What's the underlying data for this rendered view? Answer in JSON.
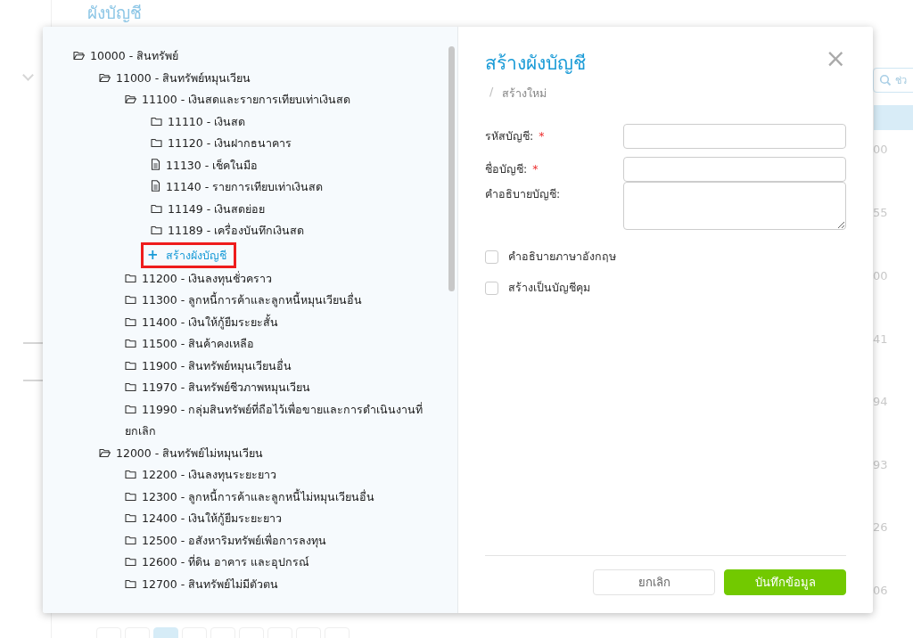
{
  "background": {
    "title": "ผังบัญชี",
    "search": {
      "kind": "search",
      "placeholder": "ช่ว"
    },
    "column_values": [
      "00",
      "55",
      "00",
      "41",
      "94",
      "93",
      "26",
      "06"
    ]
  },
  "tree": [
    {
      "label": "10000 - สินทรัพย์",
      "kind": "folder",
      "expanded": true,
      "children": [
        {
          "label": "11000 - สินทรัพย์หมุนเวียน",
          "kind": "folder",
          "expanded": true,
          "children": [
            {
              "label": "11100 - เงินสดและรายการเทียบเท่าเงินสด",
              "kind": "folder",
              "expanded": true,
              "children": [
                {
                  "label": "11110 - เงินสด",
                  "kind": "folder",
                  "expanded": false
                },
                {
                  "label": "11120 - เงินฝากธนาคาร",
                  "kind": "folder",
                  "expanded": false
                },
                {
                  "label": "11130 - เช็คในมือ",
                  "kind": "file"
                },
                {
                  "label": "11140 - รายการเทียบเท่าเงินสด",
                  "kind": "file"
                },
                {
                  "label": "11149 - เงินสดย่อย",
                  "kind": "folder",
                  "expanded": false
                },
                {
                  "label": "11189 - เครื่องบันทึกเงินสด",
                  "kind": "folder",
                  "expanded": false
                },
                {
                  "label": "สร้างผังบัญชี",
                  "kind": "action",
                  "icon": "+",
                  "highlighted": true
                }
              ]
            },
            {
              "label": "11200 - เงินลงทุนชั่วคราว",
              "kind": "folder",
              "expanded": false
            },
            {
              "label": "11300 - ลูกหนี้การค้าและลูกหนี้หมุนเวียนอื่น",
              "kind": "folder",
              "expanded": false
            },
            {
              "label": "11400 - เงินให้กู้ยืมระยะสั้น",
              "kind": "folder",
              "expanded": false
            },
            {
              "label": "11500 - สินค้าคงเหลือ",
              "kind": "folder",
              "expanded": false
            },
            {
              "label": "11900 - สินทรัพย์หมุนเวียนอื่น",
              "kind": "folder",
              "expanded": false
            },
            {
              "label": "11970 - สินทรัพย์ชีวภาพหมุนเวียน",
              "kind": "folder",
              "expanded": false
            },
            {
              "label": "11990 - กลุ่มสินทรัพย์ที่ถือไว้เพื่อขายและการดำเนินงานที่ยกเลิก",
              "kind": "folder",
              "expanded": false
            }
          ]
        },
        {
          "label": "12000 - สินทรัพย์ไม่หมุนเวียน",
          "kind": "folder",
          "expanded": true,
          "children": [
            {
              "label": "12200 - เงินลงทุนระยะยาว",
              "kind": "folder",
              "expanded": false
            },
            {
              "label": "12300 - ลูกหนี้การค้าและลูกหนี้ไม่หมุนเวียนอื่น",
              "kind": "folder",
              "expanded": false
            },
            {
              "label": "12400 - เงินให้กู้ยืมระยะยาว",
              "kind": "folder",
              "expanded": false
            },
            {
              "label": "12500 - อสังหาริมทรัพย์เพื่อการลงทุน",
              "kind": "folder",
              "expanded": false
            },
            {
              "label": "12600 - ที่ดิน อาคาร และอุปกรณ์",
              "kind": "folder",
              "expanded": false
            },
            {
              "label": "12700 - สินทรัพย์ไม่มีตัวตน",
              "kind": "folder",
              "expanded": false
            }
          ]
        }
      ]
    }
  ],
  "form": {
    "title": "สร้างผังบัญชี",
    "breadcrumb": {
      "separator": "/",
      "label": "สร้างใหม่"
    },
    "fields": [
      {
        "label": "รหัสบัญชี:",
        "required": true,
        "kind": "input"
      },
      {
        "label": "ชื่อบัญชี:",
        "required": true,
        "kind": "input"
      },
      {
        "label": "คำอธิบายบัญชี:",
        "required": false,
        "kind": "textarea"
      }
    ],
    "required_mark": "*",
    "checkboxes": [
      {
        "label": "คำอธิบายภาษาอังกฤษ",
        "checked": false
      },
      {
        "label": "สร้างเป็นบัญชีคุม",
        "checked": false
      }
    ],
    "close": "×",
    "buttons": [
      {
        "label": "ยกเลิก",
        "kind": "secondary"
      },
      {
        "label": "บันทึกข้อมูล",
        "kind": "primary"
      }
    ]
  }
}
